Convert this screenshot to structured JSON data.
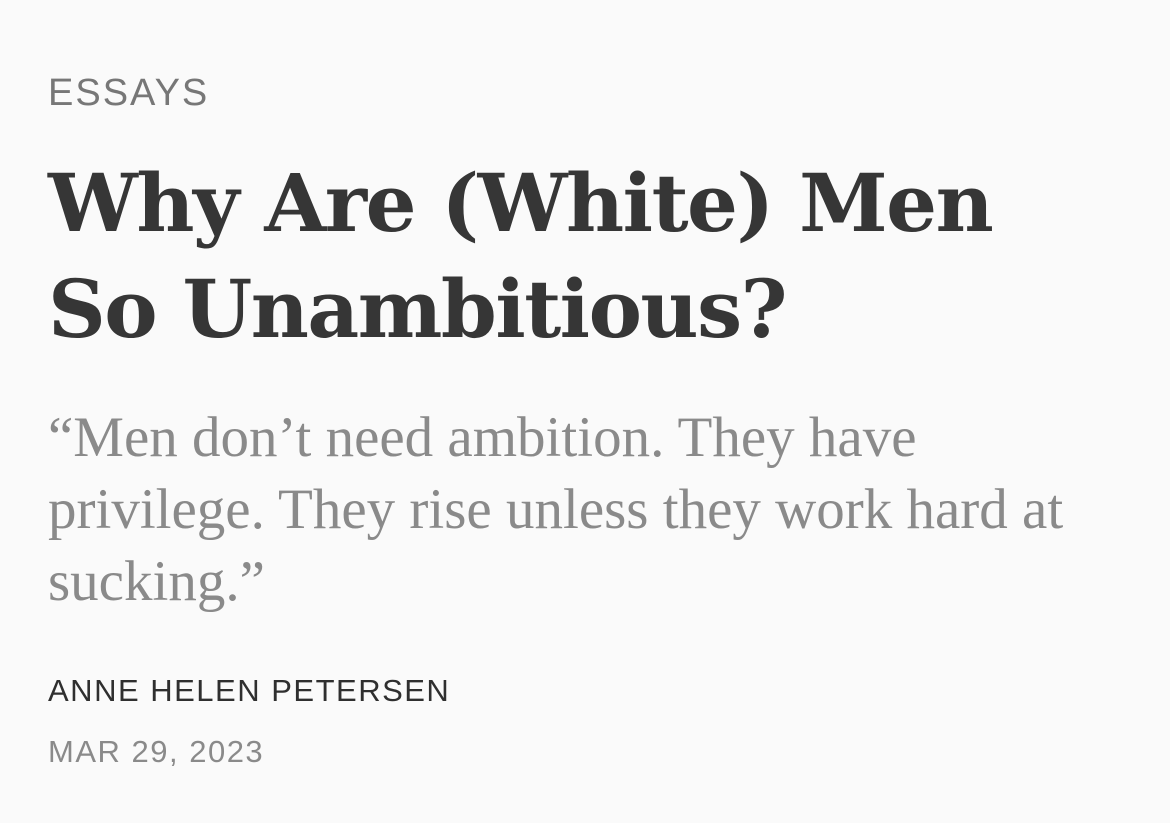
{
  "article": {
    "section": "ESSAYS",
    "title_line1": "Why Are (White) Men",
    "title_line2": "So Unambitious?",
    "subtitle": "“Men don’t need ambition. They have privilege. They rise unless they work hard at sucking.”",
    "author": "ANNE HELEN PETERSEN",
    "date": "MAR 29, 2023"
  },
  "colors": {
    "background": "#fafafa",
    "title": "#363636",
    "muted": "#8a8a8a",
    "byline": "#2f2f2f"
  }
}
